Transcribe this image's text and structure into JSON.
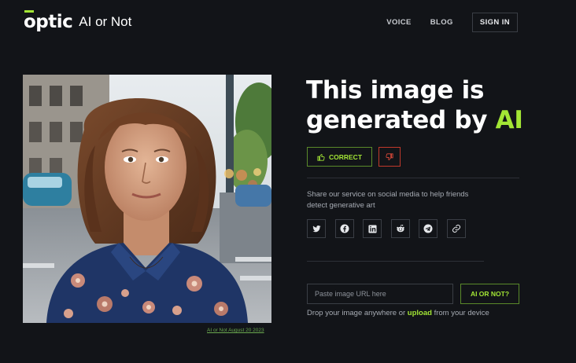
{
  "brand": {
    "logo_word": "optic",
    "product_name": "AI or Not",
    "accent_color": "#a3e635"
  },
  "nav": {
    "voice": "VOICE",
    "blog": "BLOG",
    "sign_in": "SIGN IN"
  },
  "result": {
    "headline_line1": "This image is",
    "headline_line2": "generated by ",
    "headline_accent": "AI",
    "correct_label": "CORRECT",
    "correct_icon": "thumbs-up-icon",
    "wrong_icon": "thumbs-down-icon"
  },
  "photo": {
    "caption": "AI or Not August 20 2023"
  },
  "share": {
    "text": "Share our service on social media to help friends detect generative art",
    "icons": [
      "twitter-icon",
      "facebook-icon",
      "linkedin-icon",
      "reddit-icon",
      "telegram-icon",
      "link-icon"
    ]
  },
  "upload": {
    "placeholder": "Paste image URL here",
    "submit_label": "AI OR NOT?",
    "drop_prefix": "Drop your image anywhere or ",
    "upload_link": "upload",
    "drop_suffix": " from your device"
  }
}
